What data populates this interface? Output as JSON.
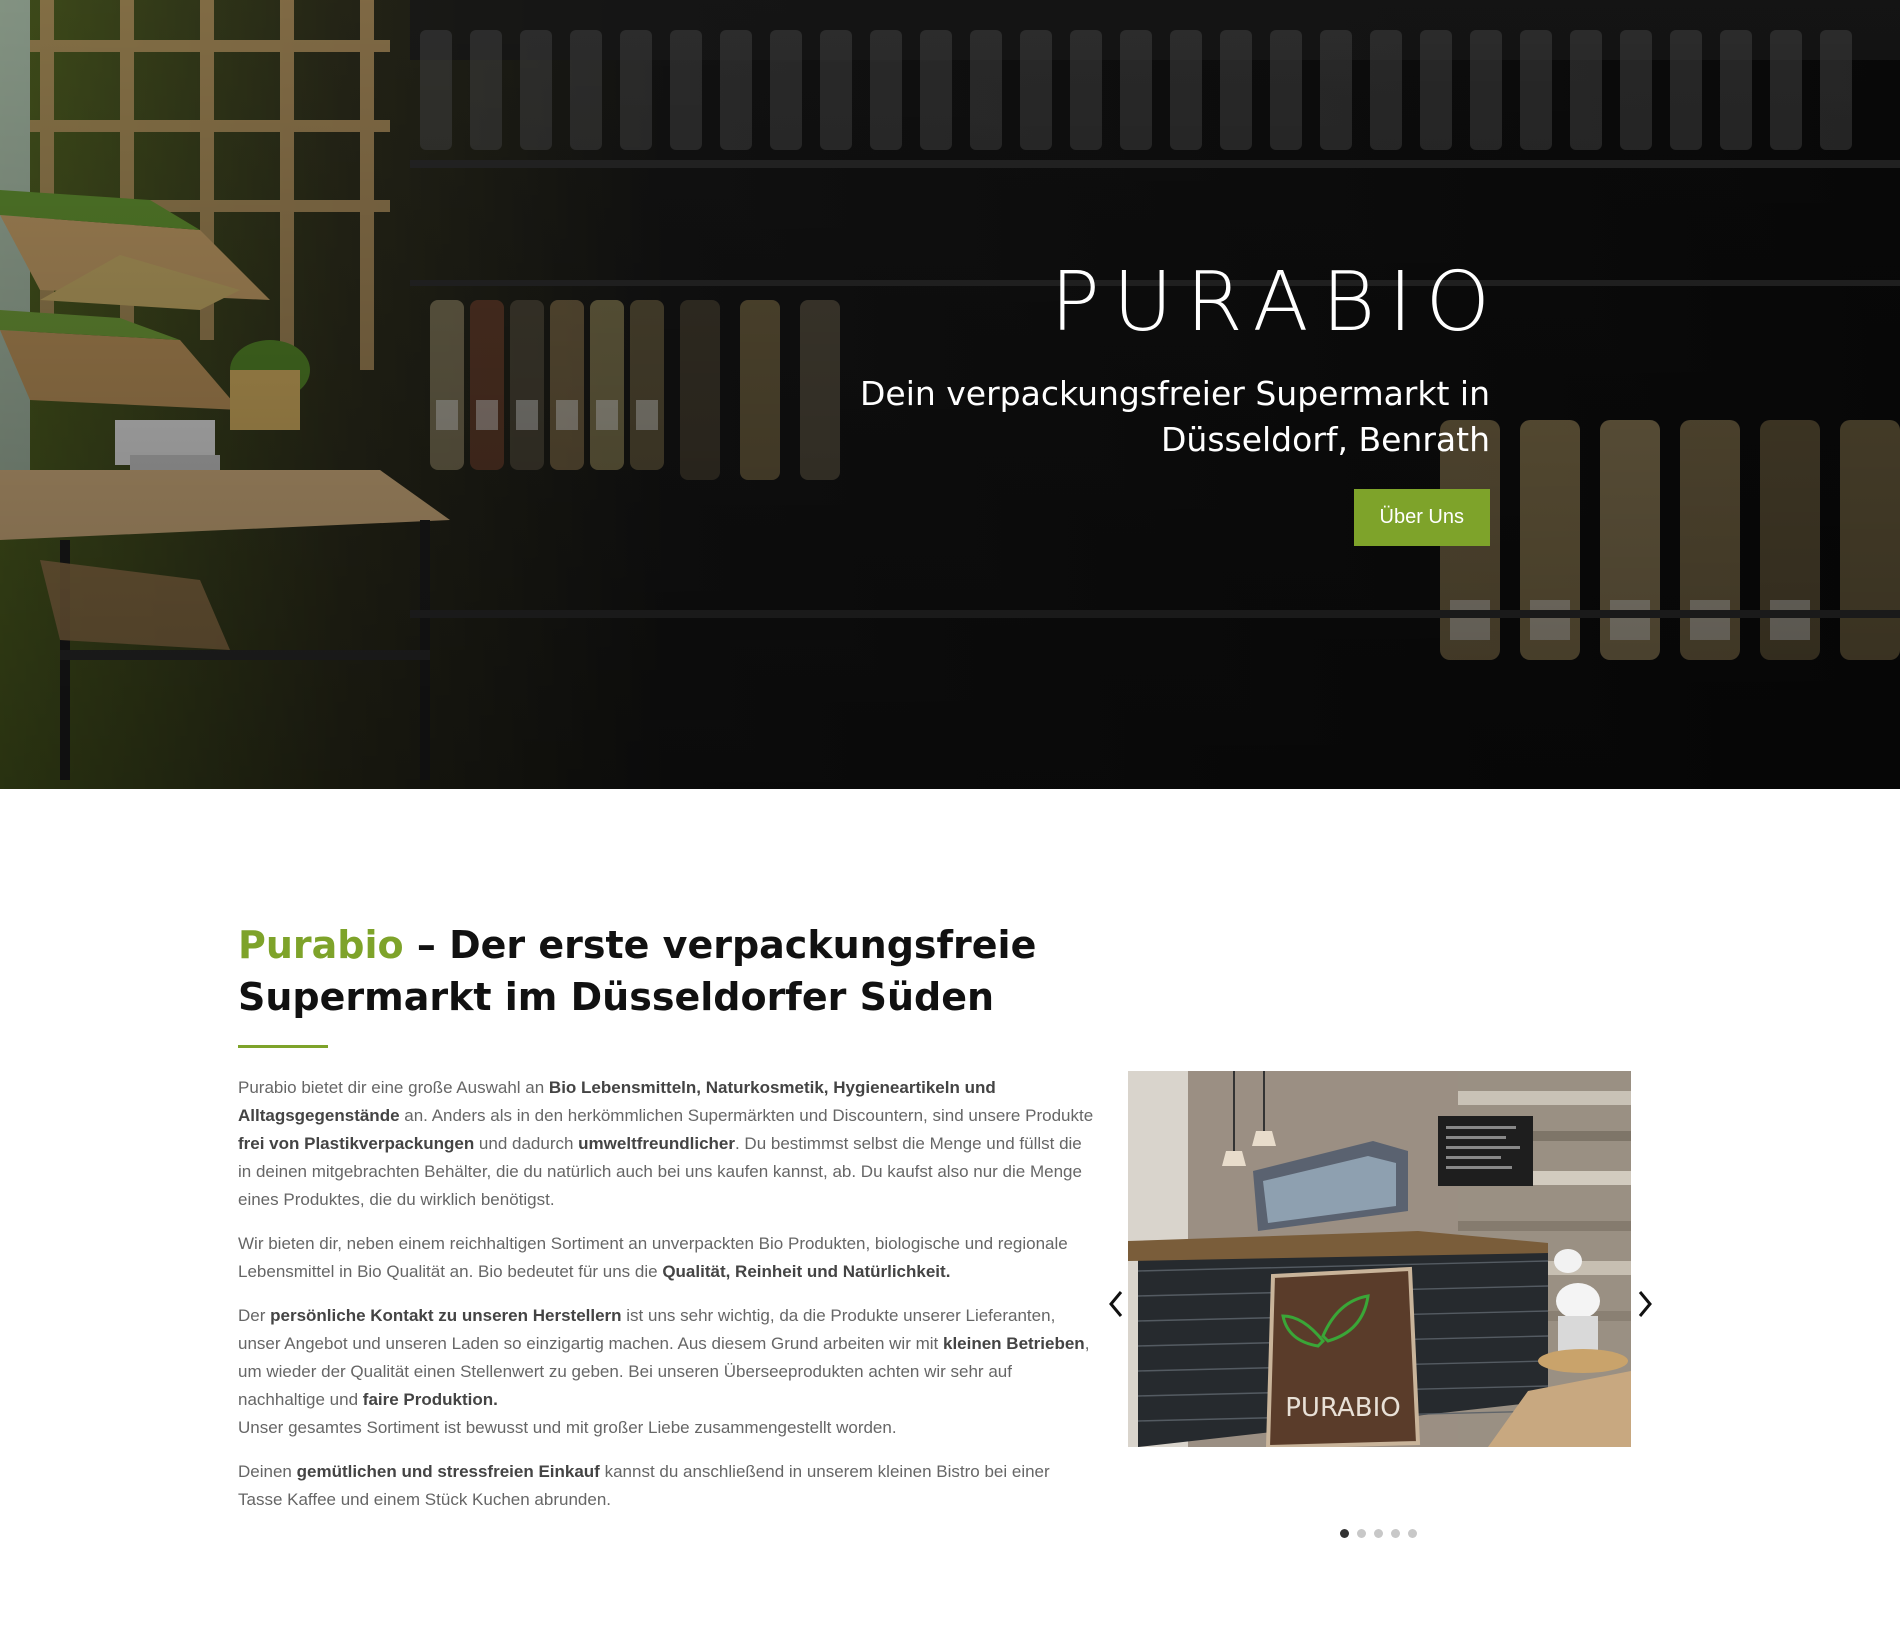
{
  "hero": {
    "title": "PURABIO",
    "subtitle": "Dein verpackungsfreier Supermarkt in Düsseldorf, Benrath",
    "button_label": "Über Uns"
  },
  "intro": {
    "heading_accent": "Purabio",
    "heading_rest": " – Der erste verpackungsfreie Supermarkt im Düsseldorfer Süden",
    "paragraphs": [
      {
        "t1": "Purabio bietet dir eine große Auswahl an ",
        "b1": "Bio Lebensmitteln, Naturkosmetik, Hygieneartikeln und Alltagsgegenstände",
        "t2": " an. Anders als in den herkömmlichen Supermärkten und Discountern, sind unsere Produkte ",
        "b2": "frei von Plastikverpackungen",
        "t3": " und dadurch ",
        "b3": "umweltfreundlicher",
        "t4": ". Du bestimmst selbst die Menge und füllst die in deinen mitgebrachten Behälter, die du natürlich auch bei uns kaufen kannst, ab. Du kaufst also nur die Menge eines Produktes, die du wirklich benötigst."
      },
      {
        "t1": "Wir bieten dir, neben einem reichhaltigen Sortiment an unverpackten Bio Produkten, biologische und regionale Lebensmittel in Bio Qualität an. Bio bedeutet für uns die ",
        "b1": "Qualität, Reinheit und Natürlichkeit."
      },
      {
        "t1": "Der ",
        "b1": "persönliche Kontakt zu unseren Herstellern",
        "t2": " ist uns sehr wichtig, da die Produkte unserer Lieferanten, unser Angebot und unseren Laden so einzigartig machen. Aus diesem Grund arbeiten wir mit ",
        "b2": "kleinen Betrieben",
        "t3": ", um wieder der Qualität einen Stellenwert zu geben. Bei unseren Überseeprodukten achten wir sehr auf nachhaltige und ",
        "b3": "faire Produktion.",
        "t4": "Unser gesamtes Sortiment ist bewusst und mit großer Liebe zusammengestellt worden."
      },
      {
        "t1": "Deinen ",
        "b1": "gemütlichen und stressfreien Einkauf",
        "t2": " kannst du anschließend in unserem kleinen Bistro bei einer Tasse Kaffee und einem Stück Kuchen abrunden."
      }
    ]
  },
  "slider": {
    "sign_text": "PURABIO",
    "dot_count": 5,
    "active_dot": 1
  },
  "colors": {
    "accent": "#7ea32a",
    "hero_bg": "#0c0c0c"
  },
  "icons": {
    "prev": "chevron-left-icon",
    "next": "chevron-right-icon"
  }
}
